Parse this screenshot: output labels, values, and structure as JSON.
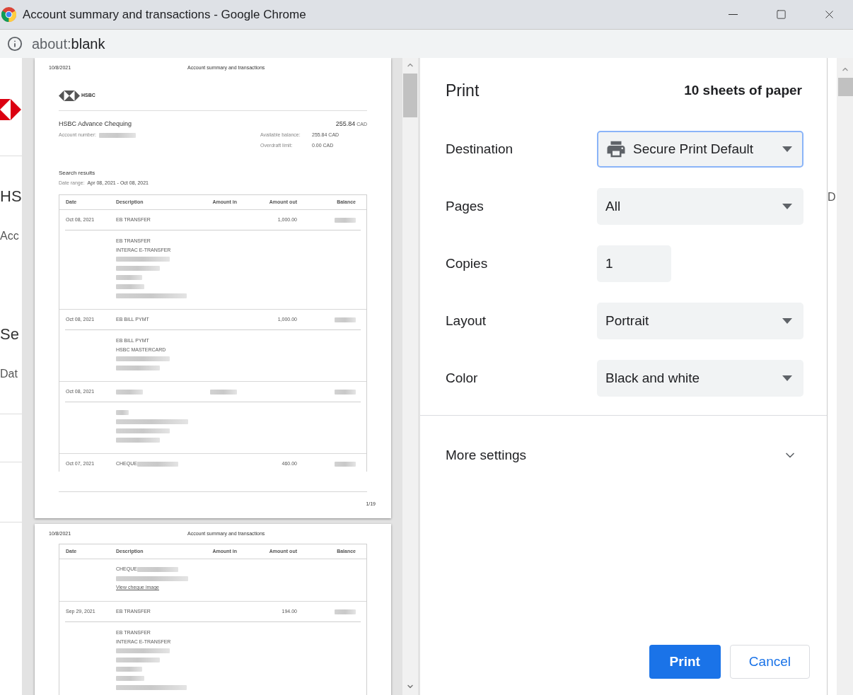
{
  "window": {
    "title": "Account summary and transactions - Google Chrome"
  },
  "address_bar": {
    "scheme": "about:",
    "path": "blank"
  },
  "background_page": {
    "left_texts": [
      {
        "kind": "heading",
        "text": "HS"
      },
      {
        "kind": "small",
        "text": "Acc"
      },
      {
        "kind": "heading",
        "text": "Se"
      },
      {
        "kind": "small",
        "text": "Dat"
      }
    ],
    "right_texts": [
      "D"
    ]
  },
  "preview": {
    "pages": [
      {
        "header_date": "10/8/2021",
        "header_title": "Account summary and transactions",
        "logo_text": "HSBC",
        "account_name": "HSBC Advance Chequing",
        "balance": "255.84",
        "balance_currency": "CAD",
        "account_number_label": "Account number:",
        "details": [
          {
            "label": "Available balance:",
            "value": "255.84 CAD"
          },
          {
            "label": "Overdraft limit:",
            "value": "0.00 CAD"
          }
        ],
        "search_title": "Search results",
        "date_range_label": "Date range:",
        "date_range": "Apr 08, 2021 - Oct 08, 2021",
        "columns": [
          "Date",
          "Description",
          "Amount in",
          "Amount out",
          "Balance"
        ],
        "rows": [
          {
            "cells": [
              {
                "kind": "text",
                "text": "Oct 08, 2021"
              },
              {
                "kind": "text",
                "text": "EB TRANSFER"
              },
              {
                "kind": "empty"
              },
              {
                "kind": "text",
                "text": "1,000.00"
              },
              {
                "kind": "redacted"
              }
            ],
            "lines": [
              {
                "kind": "text",
                "text": "EB TRANSFER"
              },
              {
                "kind": "text",
                "text": "INTERAC E-TRANSFER"
              },
              {
                "kind": "redacted"
              },
              {
                "kind": "redacted"
              },
              {
                "kind": "redacted"
              },
              {
                "kind": "redacted"
              },
              {
                "kind": "redacted"
              }
            ]
          },
          {
            "cells": [
              {
                "kind": "text",
                "text": "Oct 08, 2021"
              },
              {
                "kind": "text",
                "text": "EB BILL PYMT"
              },
              {
                "kind": "empty"
              },
              {
                "kind": "text",
                "text": "1,000.00"
              },
              {
                "kind": "redacted"
              }
            ],
            "lines": [
              {
                "kind": "text",
                "text": "EB BILL PYMT"
              },
              {
                "kind": "text",
                "text": "HSBC MASTERCARD"
              },
              {
                "kind": "redacted"
              },
              {
                "kind": "redacted"
              }
            ]
          },
          {
            "cells": [
              {
                "kind": "text",
                "text": "Oct 08, 2021"
              },
              {
                "kind": "redacted"
              },
              {
                "kind": "redacted"
              },
              {
                "kind": "empty"
              },
              {
                "kind": "redacted"
              }
            ],
            "lines": [
              {
                "kind": "redacted"
              },
              {
                "kind": "redacted"
              },
              {
                "kind": "redacted"
              },
              {
                "kind": "redacted"
              }
            ]
          },
          {
            "cells": [
              {
                "kind": "text",
                "text": "Oct 07, 2021"
              },
              {
                "kind": "text_redacted",
                "text": "CHEQUE"
              },
              {
                "kind": "empty"
              },
              {
                "kind": "text",
                "text": "460.00"
              },
              {
                "kind": "redacted"
              }
            ]
          }
        ],
        "page_number": "1/19"
      },
      {
        "header_date": "10/8/2021",
        "header_title": "Account summary and transactions",
        "columns": [
          "Date",
          "Description",
          "Amount in",
          "Amount out",
          "Balance"
        ],
        "rows": [
          {
            "lines": [
              {
                "kind": "text_redacted",
                "text": "CHEQUE"
              },
              {
                "kind": "redacted"
              },
              {
                "kind": "link",
                "text": "View cheque image"
              }
            ]
          },
          {
            "cells": [
              {
                "kind": "text",
                "text": "Sep 29, 2021"
              },
              {
                "kind": "text",
                "text": "EB TRANSFER"
              },
              {
                "kind": "empty"
              },
              {
                "kind": "text",
                "text": "194.00"
              },
              {
                "kind": "redacted"
              }
            ],
            "lines": [
              {
                "kind": "text",
                "text": "EB TRANSFER"
              },
              {
                "kind": "text",
                "text": "INTERAC E-TRANSFER"
              },
              {
                "kind": "redacted"
              },
              {
                "kind": "redacted"
              },
              {
                "kind": "redacted"
              },
              {
                "kind": "redacted"
              },
              {
                "kind": "redacted"
              }
            ]
          }
        ]
      }
    ]
  },
  "settings": {
    "title": "Print",
    "summary": "10 sheets of paper",
    "fields": [
      {
        "label": "Destination",
        "kind": "destination",
        "value": "Secure Print Default",
        "focused": true
      },
      {
        "label": "Pages",
        "kind": "dropdown",
        "value": "All",
        "focused": false
      },
      {
        "label": "Copies",
        "kind": "input",
        "value": "1",
        "focused": false
      },
      {
        "label": "Layout",
        "kind": "dropdown",
        "value": "Portrait",
        "focused": false
      },
      {
        "label": "Color",
        "kind": "dropdown",
        "value": "Black and white",
        "focused": false
      }
    ],
    "more_settings": {
      "label": "More settings",
      "expanded": false
    },
    "buttons": [
      {
        "label": "Print",
        "kind": "primary"
      },
      {
        "label": "Cancel",
        "kind": "secondary"
      }
    ]
  }
}
